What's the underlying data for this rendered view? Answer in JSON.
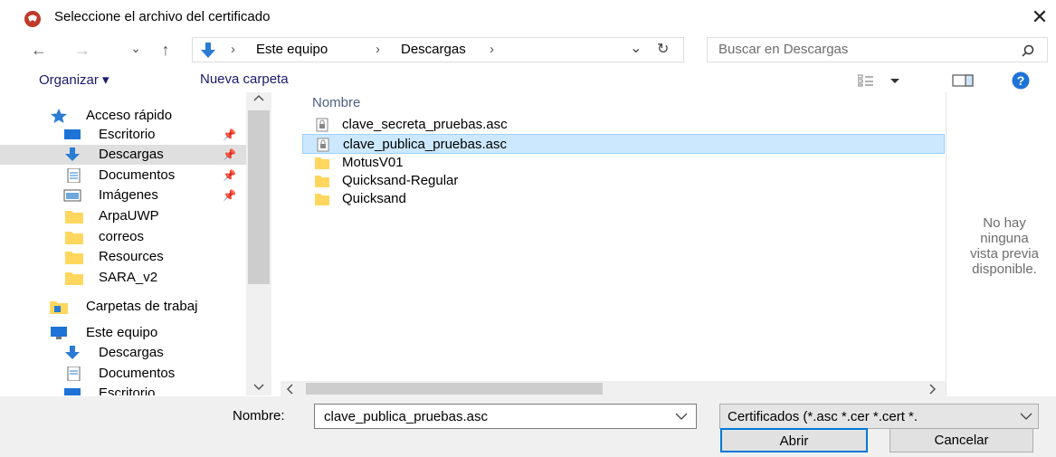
{
  "window": {
    "title": "Seleccione el archivo del certificado",
    "close_glyph": "✕"
  },
  "nav": {
    "back": "←",
    "forward": "→",
    "recent": "⌄",
    "up": "↑",
    "breadcrumb": [
      "Este equipo",
      "Descargas"
    ],
    "sep": "›",
    "dropdown": "⌄",
    "refresh": "↻",
    "search_placeholder": "Buscar en Descargas"
  },
  "toolbar": {
    "organize": "Organizar ▾",
    "new_folder": "Nueva carpeta"
  },
  "sidebar": {
    "quick_access": "Acceso rápido",
    "quick_items": [
      {
        "label": "Escritorio",
        "icon": "desktop-icon"
      },
      {
        "label": "Descargas",
        "icon": "download-icon"
      },
      {
        "label": "Documentos",
        "icon": "document-icon"
      },
      {
        "label": "Imágenes",
        "icon": "images-icon"
      },
      {
        "label": "ArpaUWP",
        "icon": "folder-icon"
      },
      {
        "label": "correos",
        "icon": "folder-icon"
      },
      {
        "label": "Resources",
        "icon": "folder-icon"
      },
      {
        "label": "SARA_v2",
        "icon": "folder-icon"
      }
    ],
    "work_folders": "Carpetas de trabaj",
    "this_pc": "Este equipo",
    "pc_items": [
      "Descargas",
      "Documentos",
      "Escritorio"
    ]
  },
  "files": {
    "column": "Nombre",
    "items": [
      {
        "name": "clave_secreta_pruebas.asc",
        "type": "file"
      },
      {
        "name": "clave_publica_pruebas.asc",
        "type": "file",
        "selected": true
      },
      {
        "name": "MotusV01",
        "type": "folder"
      },
      {
        "name": "Quicksand-Regular",
        "type": "folder"
      },
      {
        "name": "Quicksand",
        "type": "folder"
      }
    ]
  },
  "preview": {
    "line1": "No hay",
    "line2": "ninguna",
    "line3": "vista previa",
    "line4": "disponible."
  },
  "bottom": {
    "name_label": "Nombre:",
    "name_value": "clave_publica_pruebas.asc",
    "filter_value": "Certificados (*.asc *.cer *.cert *.",
    "open": "Abrir",
    "cancel": "Cancelar"
  },
  "colors": {
    "accent": "#0078d7",
    "selection": "#cce8ff",
    "folder": "#ffd75e",
    "app_icon": "#c0392b"
  }
}
